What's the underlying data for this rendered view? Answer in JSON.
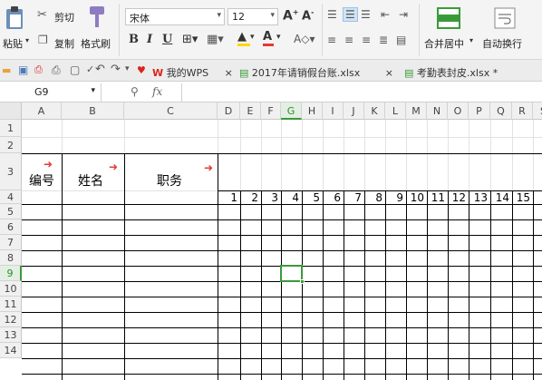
{
  "ribbon": {
    "paste": "粘贴",
    "cut": "剪切",
    "copy": "复制",
    "format_painter": "格式刷",
    "font_name": "宋体",
    "font_size": "12",
    "merge_center": "合并居中",
    "wrap_text": "自动换行",
    "bold": "B",
    "italic": "I",
    "underline": "U"
  },
  "tabs": [
    {
      "label": "我的WPS"
    },
    {
      "label": "2017年请销假台账.xlsx"
    },
    {
      "label": "考勤表封皮.xlsx *"
    }
  ],
  "formula_bar": {
    "name_box": "G9",
    "fx": "fx"
  },
  "columns": [
    "A",
    "B",
    "C",
    "D",
    "E",
    "F",
    "G",
    "H",
    "I",
    "J",
    "K",
    "L",
    "M",
    "N",
    "O",
    "P",
    "Q",
    "R",
    "S"
  ],
  "rows": [
    "1",
    "2",
    "3",
    "4",
    "5",
    "6",
    "7",
    "8",
    "9",
    "10",
    "11",
    "12",
    "13",
    "14"
  ],
  "headers": {
    "number": "编号",
    "name": "姓名",
    "position": "职务"
  },
  "days": [
    "1",
    "2",
    "3",
    "4",
    "5",
    "6",
    "7",
    "8",
    "9",
    "10",
    "11",
    "12",
    "13",
    "14",
    "15"
  ],
  "selected_cell": "G9",
  "colors": {
    "accent_green": "#3a9a3a",
    "arrow_red": "#e53935",
    "wps_red": "#d9251c"
  }
}
